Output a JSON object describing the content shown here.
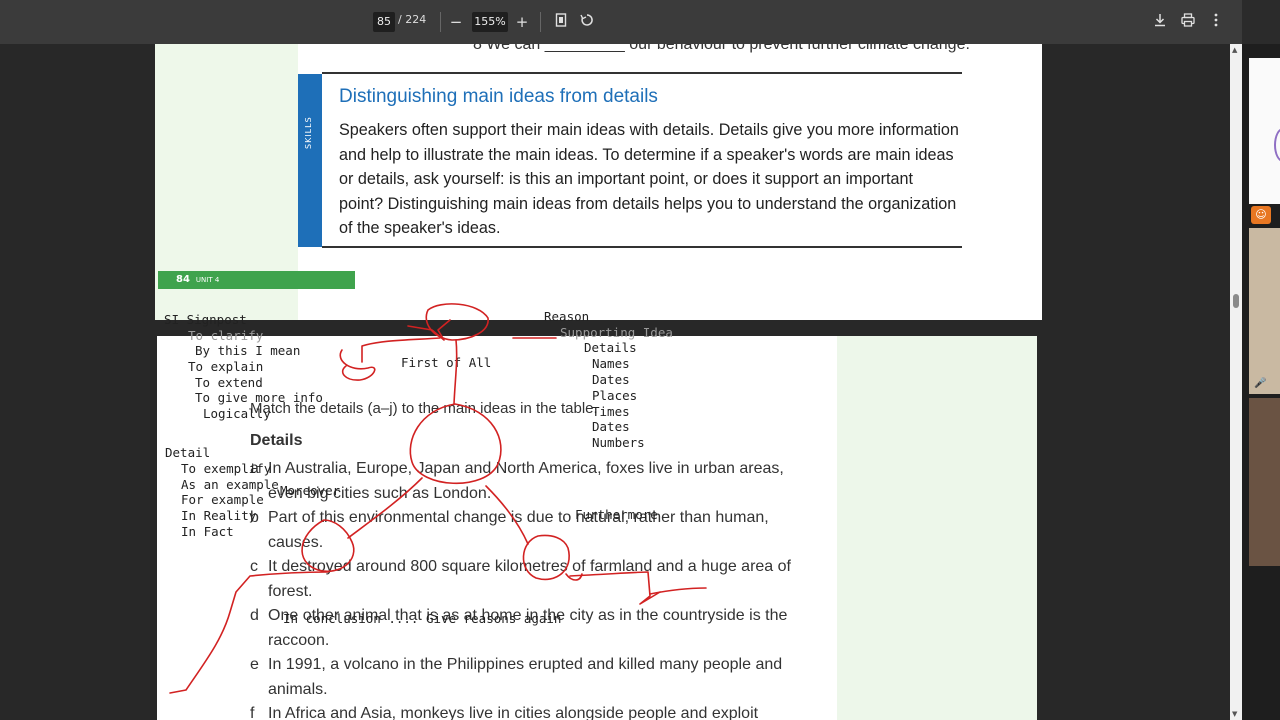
{
  "toolbar": {
    "page_current": "85",
    "page_total": "/ 224",
    "zoom_out": "−",
    "zoom_value": "155%",
    "zoom_in": "+",
    "fit_icon": "fit-page-icon",
    "rotate_icon": "rotate-icon",
    "download_icon": "download-icon",
    "print_icon": "print-icon",
    "more_icon": "more-vert-icon"
  },
  "page1": {
    "cut_line": "8  We can _________ our behaviour to prevent further climate change.",
    "skills_label": "SKILLS",
    "title": "Distinguishing main ideas from details",
    "body": "Speakers often support their main ideas with details. Details give you more information and help to illustrate the main ideas. To determine if a speaker's words are main ideas or details, ask yourself: is this an important point, or does it support an important point? Distinguishing main ideas from details helps you to understand the organization of the speaker's ideas.",
    "unit_number": "84",
    "unit_label": "UNIT 4"
  },
  "page2": {
    "instruction": "Match the details (a–j) to the main ideas in the table.",
    "heading": "Details",
    "items": [
      {
        "letter": "a",
        "text": "In Australia, Europe, Japan and North America, foxes live in urban areas, even big cities such as London."
      },
      {
        "letter": "b",
        "text": "Part of this environmental change is due to natural, rather than human, causes."
      },
      {
        "letter": "c",
        "text": "It destroyed around 800 square kilometres of farmland and a huge area of forest."
      },
      {
        "letter": "d",
        "text": "One other animal that is as at home in the city as in the countryside is the raccoon."
      },
      {
        "letter": "e",
        "text": "In 1991, a volcano in the Philippines erupted and killed many people and animals."
      },
      {
        "letter": "f",
        "text": "In Africa and Asia, monkeys live in cities alongside people and exploit"
      }
    ]
  },
  "notes": {
    "left": [
      "SI Signpost",
      "To clarify",
      "By this I mean",
      "To explain",
      "To extend",
      "To give more info",
      "Logically"
    ],
    "detail": [
      "Detail",
      "To exemplify",
      "As an example",
      "For example",
      "In Reality",
      "In Fact"
    ],
    "reason": "Reason",
    "supporting": "Supporting Idea",
    "details_list": [
      "Details",
      "Names",
      "Dates",
      "Places",
      "Times",
      "Dates",
      "Numbers"
    ],
    "first": "First of All",
    "moreover": "Moreover",
    "furthermore": "Furthermore",
    "conclusion": "In conclusion ....  Give reasons again"
  },
  "side": {
    "badge_icon": "person-icon",
    "mic_icon": "mic-icon"
  },
  "colors": {
    "skills_blue": "#1e6fb8",
    "unit_green": "#3fa34d",
    "ink_red": "#d22222"
  }
}
